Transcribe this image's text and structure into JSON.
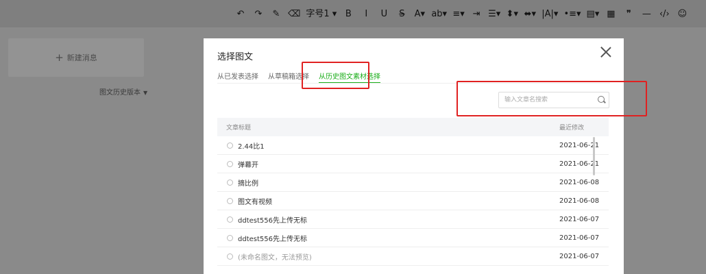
{
  "toolbar": {
    "tools": [
      {
        "icon": "undo-icon",
        "glyph": "↶"
      },
      {
        "icon": "redo-icon",
        "glyph": "↷"
      },
      {
        "icon": "format-brush-icon",
        "glyph": "✎"
      },
      {
        "icon": "clear-format-icon",
        "glyph": "⌫"
      },
      {
        "icon": "font-size-icon",
        "glyph": "字号1 ▾"
      },
      {
        "icon": "bold-icon",
        "glyph": "B"
      },
      {
        "icon": "italic-icon",
        "glyph": "I"
      },
      {
        "icon": "underline-icon",
        "glyph": "U"
      },
      {
        "icon": "strikethrough-icon",
        "glyph": "S̶"
      },
      {
        "icon": "font-color-icon",
        "glyph": "A▾"
      },
      {
        "icon": "background-color-icon",
        "glyph": "ab▾"
      },
      {
        "icon": "align-icon",
        "glyph": "≡▾"
      },
      {
        "icon": "indent-icon",
        "glyph": "⇥"
      },
      {
        "icon": "line-height-icon",
        "glyph": "☰▾"
      },
      {
        "icon": "paragraph-spacing-before-icon",
        "glyph": "⬍▾"
      },
      {
        "icon": "paragraph-spacing-after-icon",
        "glyph": "⬌▾"
      },
      {
        "icon": "letter-spacing-icon",
        "glyph": "|A|▾"
      },
      {
        "icon": "unordered-list-icon",
        "glyph": "•≡▾"
      },
      {
        "icon": "ordered-list-icon",
        "glyph": "▤▾"
      },
      {
        "icon": "table-icon",
        "glyph": "▦"
      },
      {
        "icon": "quote-icon",
        "glyph": "❞"
      },
      {
        "icon": "divider-icon",
        "glyph": "—"
      },
      {
        "icon": "code-icon",
        "glyph": "‹/›"
      },
      {
        "icon": "emoji-icon",
        "glyph": "☺"
      }
    ]
  },
  "left": {
    "new_message": "新建消息",
    "history_version": "图文历史版本"
  },
  "dialog": {
    "title": "选择图文",
    "tabs": [
      {
        "label": "从已发表选择",
        "active": false
      },
      {
        "label": "从草稿箱选择",
        "active": false
      },
      {
        "label": "从历史图文素材选择",
        "active": true
      }
    ],
    "search_placeholder": "输入文章名搜索",
    "search_value": "",
    "table": {
      "headers": {
        "title": "文章标题",
        "date": "最近修改"
      },
      "rows": [
        {
          "title": "2.44比1",
          "date": "2021-06-21",
          "muted": false
        },
        {
          "title": "弹幕开",
          "date": "2021-06-21",
          "muted": false
        },
        {
          "title": "摘比例",
          "date": "2021-06-08",
          "muted": false
        },
        {
          "title": "图文有视频",
          "date": "2021-06-08",
          "muted": false
        },
        {
          "title": "ddtest556先上传无标",
          "date": "2021-06-07",
          "muted": false
        },
        {
          "title": "ddtest556先上传无标",
          "date": "2021-06-07",
          "muted": false
        },
        {
          "title": "(未命名图文，无法预览)",
          "date": "2021-06-07",
          "muted": true
        }
      ]
    }
  },
  "colors": {
    "accent": "#1aad19",
    "highlight_box": "#e02020",
    "overlay": "#8a8a8a"
  }
}
